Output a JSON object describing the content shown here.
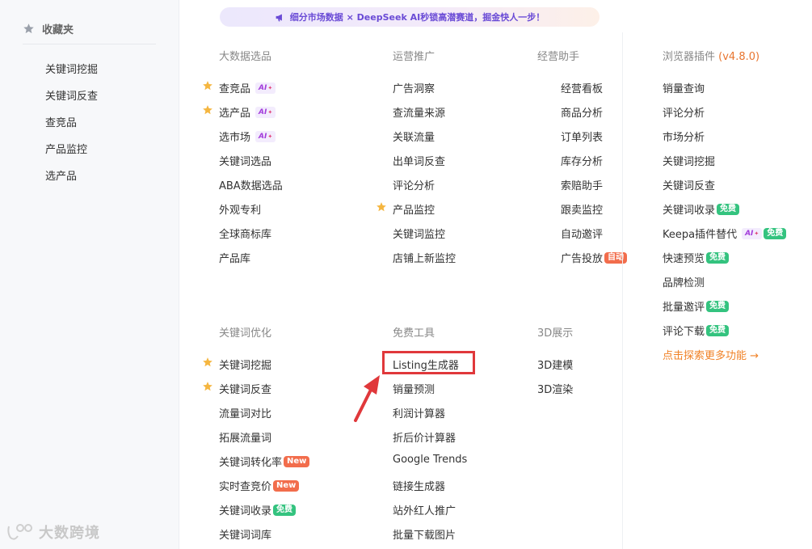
{
  "banner": {
    "text": "细分市场数据 × DeepSeek AI秒锁高潜赛道，掘金快人一步！"
  },
  "sidebar": {
    "title": "收藏夹",
    "items": [
      {
        "label": "关键词挖掘"
      },
      {
        "label": "关键词反查"
      },
      {
        "label": "查竞品"
      },
      {
        "label": "产品监控"
      },
      {
        "label": "选产品"
      }
    ],
    "watermark": "大数跨境"
  },
  "sections": {
    "bigdata": {
      "title": "大数据选品",
      "items": [
        {
          "label": "查竞品",
          "ai": "AI",
          "starred": true
        },
        {
          "label": "选产品",
          "ai": "AI",
          "starred": true
        },
        {
          "label": "选市场",
          "ai": "AI"
        },
        {
          "label": "关键词选品"
        },
        {
          "label": "ABA数据选品"
        },
        {
          "label": "外观专利"
        },
        {
          "label": "全球商标库"
        },
        {
          "label": "产品库"
        }
      ]
    },
    "promotion": {
      "title": "运营推广",
      "items": [
        {
          "label": "广告洞察"
        },
        {
          "label": "查流量来源"
        },
        {
          "label": "关联流量"
        },
        {
          "label": "出单词反查"
        },
        {
          "label": "评论分析"
        },
        {
          "label": "产品监控",
          "starred": true
        },
        {
          "label": "关键词监控"
        },
        {
          "label": "店铺上新监控"
        }
      ]
    },
    "assistant": {
      "title": "经营助手",
      "items": [
        {
          "label": "经营看板"
        },
        {
          "label": "商品分析"
        },
        {
          "label": "订单列表"
        },
        {
          "label": "库存分析"
        },
        {
          "label": "索赔助手"
        },
        {
          "label": "跟卖监控"
        },
        {
          "label": "自动邀评"
        },
        {
          "label": "广告投放",
          "badge": "自动"
        }
      ]
    },
    "plugin": {
      "title": "浏览器插件",
      "version": "(v4.8.0)",
      "items": [
        {
          "label": "销量查询"
        },
        {
          "label": "评论分析"
        },
        {
          "label": "市场分析"
        },
        {
          "label": "关键词挖掘"
        },
        {
          "label": "关键词反查"
        },
        {
          "label": "关键词收录",
          "badge": "免费"
        },
        {
          "label": "Keepa插件替代",
          "ai": "AI",
          "badge": "免费"
        },
        {
          "label": "快速预览",
          "badge": "免费"
        },
        {
          "label": "品牌检测"
        },
        {
          "label": "批量邀评",
          "badge": "免费"
        },
        {
          "label": "评论下载",
          "badge": "免费"
        }
      ],
      "more": "点击探索更多功能 →"
    },
    "keyword": {
      "title": "关键词优化",
      "items": [
        {
          "label": "关键词挖掘",
          "starred": true
        },
        {
          "label": "关键词反查",
          "starred": true
        },
        {
          "label": "流量词对比"
        },
        {
          "label": "拓展流量词"
        },
        {
          "label": "关键词转化率",
          "badge": "New"
        },
        {
          "label": "实时查竞价",
          "badge": "New"
        },
        {
          "label": "关键词收录",
          "badge": "免费"
        },
        {
          "label": "关键词词库"
        }
      ]
    },
    "free": {
      "title": "免费工具",
      "items": [
        {
          "label": "Listing生成器"
        },
        {
          "label": "销量预测"
        },
        {
          "label": "利润计算器"
        },
        {
          "label": "折后价计算器"
        },
        {
          "label": "Google Trends"
        },
        {
          "label": "链接生成器"
        },
        {
          "label": "站外红人推广"
        },
        {
          "label": "批量下载图片"
        }
      ]
    },
    "display3d": {
      "title": "3D展示",
      "items": [
        {
          "label": "3D建模"
        },
        {
          "label": "3D渲染"
        }
      ]
    }
  },
  "colors": {
    "accent": "#e8742e",
    "free_badge": "#34c37f",
    "new_badge": "#f26d4c",
    "highlight": "#e0383b"
  }
}
